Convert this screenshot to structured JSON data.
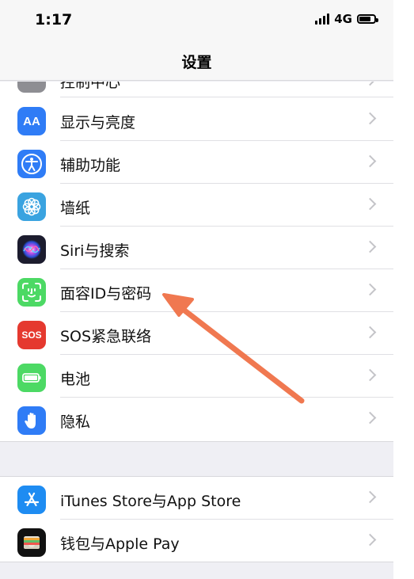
{
  "status_bar": {
    "time": "1:17",
    "network": "4G",
    "battery_level": 0.8
  },
  "nav": {
    "title": "设置"
  },
  "colors": {
    "display": "#2f7cf6",
    "accessibility": "#2f7cf6",
    "wallpaper": "#3aa3e0",
    "siri": "#1c1c2e",
    "faceid": "#4cd964",
    "sos": "#e5392f",
    "battery": "#4cd964",
    "privacy": "#2f7cf6",
    "appstore": "#1e8cf2",
    "wallet": "#111111",
    "annotation_arrow": "#f07850"
  },
  "group1": {
    "partial_label": "控制中心",
    "items": [
      {
        "label": "显示与亮度",
        "icon": "text-size-icon"
      },
      {
        "label": "辅助功能",
        "icon": "accessibility-icon"
      },
      {
        "label": "墙纸",
        "icon": "flower-icon"
      },
      {
        "label": "Siri与搜索",
        "icon": "siri-icon"
      },
      {
        "label": "面容ID与密码",
        "icon": "face-id-icon"
      },
      {
        "label": "SOS紧急联络",
        "icon": "sos-icon",
        "icon_text": "SOS"
      },
      {
        "label": "电池",
        "icon": "battery-icon"
      },
      {
        "label": "隐私",
        "icon": "hand-icon"
      }
    ]
  },
  "group2": {
    "items": [
      {
        "label": "iTunes Store与App Store",
        "icon": "app-store-icon"
      },
      {
        "label": "钱包与Apple Pay",
        "icon": "wallet-icon"
      }
    ]
  },
  "icons": {
    "display_text": "AA"
  }
}
